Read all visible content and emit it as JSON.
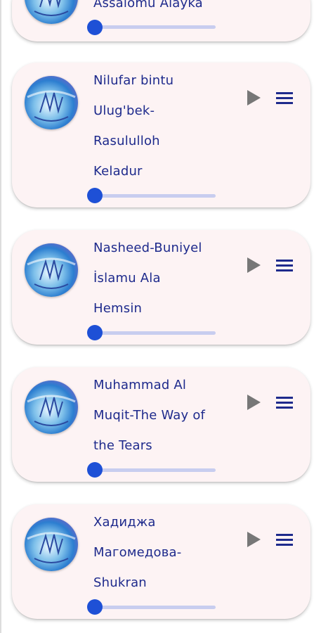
{
  "tracks": [
    {
      "title_lines": [
        "Assalomu Alayka"
      ],
      "progress": 0
    },
    {
      "title_lines": [
        "Nilufar bintu",
        "Ulug'bek-",
        "Rasululloh",
        "Keladur"
      ],
      "progress": 0
    },
    {
      "title_lines": [
        "Nasheed-Buniyel",
        "İslamu Ala",
        "Hemsin"
      ],
      "progress": 0
    },
    {
      "title_lines": [
        "Muhammad Al",
        "Muqit-The Way of",
        "the Tears"
      ],
      "progress": 0
    },
    {
      "title_lines": [
        "Хадиджа",
        "Магомедова-",
        "Shukran"
      ],
      "progress": 0
    }
  ],
  "colors": {
    "card_bg": "#fdf3f4",
    "title_text": "#1e2a8c",
    "play_icon": "#777777",
    "menu_icon": "#1e2a8c",
    "slider_thumb": "#1e50d6",
    "slider_track": "#c8cdef"
  },
  "icons": {
    "play": "play-icon",
    "menu": "menu-icon",
    "cover": "album-art"
  }
}
